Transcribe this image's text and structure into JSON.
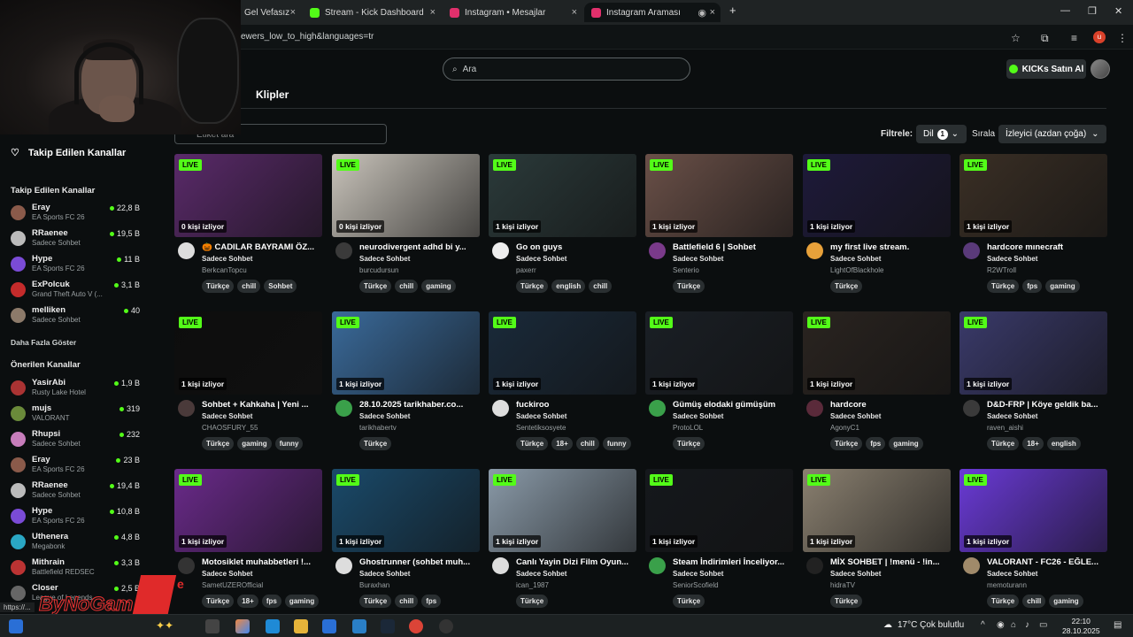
{
  "browser": {
    "tabs": [
      {
        "label": "Gel Vefasız",
        "favicon_color": "#444444"
      },
      {
        "label": "Stream - Kick Dashboard",
        "favicon_color": "#53fc18"
      },
      {
        "label": "Instagram • Mesajlar",
        "favicon_color": "#e1306c"
      },
      {
        "label": "Instagram Araması",
        "favicon_color": "#e1306c"
      }
    ],
    "new_tab": "+",
    "url": "ewers_low_to_high&languages=tr",
    "profile_initial": "u"
  },
  "header": {
    "search_placeholder": "Ara",
    "kicks_label": "KICKs Satın Al",
    "section_title": "Klipler"
  },
  "filters": {
    "tag_placeholder": "Etiket ara",
    "filter_label": "Filtrele:",
    "language_label": "Dil",
    "language_count": "1",
    "sort_label": "Sırala",
    "sort_value": "İzleyici (azdan çoğa)"
  },
  "sidebar": {
    "title": "Takip Edilen Kanallar",
    "followed_title": "Takip Edilen Kanallar",
    "followed": [
      {
        "name": "Eray",
        "game": "EA Sports FC 26",
        "viewers": "22,8 B",
        "color": "#8a5a4a"
      },
      {
        "name": "RRaenee",
        "game": "Sadece Sohbet",
        "viewers": "19,5 B",
        "color": "#bbbbbb"
      },
      {
        "name": "Hype",
        "game": "EA Sports FC 26",
        "viewers": "11 B",
        "color": "#7a4bd6"
      },
      {
        "name": "ExPolcuk",
        "game": "Grand Theft Auto V (...",
        "viewers": "3,1 B",
        "color": "#c42b2b"
      },
      {
        "name": "melliken",
        "game": "Sadece Sohbet",
        "viewers": "40",
        "color": "#8c7a6a"
      }
    ],
    "more_label": "Daha Fazla Göster",
    "recommended_title": "Önerilen Kanallar",
    "recommended": [
      {
        "name": "YasirAbi",
        "game": "Rusty Lake Hotel",
        "viewers": "1,9 B",
        "color": "#a33"
      },
      {
        "name": "mujs",
        "game": "VALORANT",
        "viewers": "319",
        "color": "#6a8a3a"
      },
      {
        "name": "Rhupsi",
        "game": "Sadece Sohbet",
        "viewers": "232",
        "color": "#c77dbb"
      },
      {
        "name": "Eray",
        "game": "EA Sports FC 26",
        "viewers": "23 B",
        "color": "#8a5a4a"
      },
      {
        "name": "RRaenee",
        "game": "Sadece Sohbet",
        "viewers": "19,4 B",
        "color": "#bbbbbb"
      },
      {
        "name": "Hype",
        "game": "EA Sports FC 26",
        "viewers": "10,8 B",
        "color": "#7a4bd6"
      },
      {
        "name": "Uthenera",
        "game": "Megabonk",
        "viewers": "4,8 B",
        "color": "#2aa7c4"
      },
      {
        "name": "Mithrain",
        "game": "Battlefield REDSEC",
        "viewers": "3,3 B",
        "color": "#b33"
      },
      {
        "name": "Closer",
        "game": "League of Legends",
        "viewers": "2,5 B",
        "color": "#666"
      }
    ]
  },
  "live_badge": "LIVE",
  "streams": [
    {
      "title": "🎃 CADILAR BAYRAMI ÖZ...",
      "category": "Sadece Sohbet",
      "user": "BerkcanTopcu",
      "viewers": "0 kişi izliyor",
      "tags": [
        "Türkçe",
        "chill",
        "Sohbet"
      ],
      "thumb": "#5a2a6a",
      "avatar": "#ddd"
    },
    {
      "title": "neurodivergent adhd bi y...",
      "category": "Sadece Sohbet",
      "user": "burcudursun",
      "viewers": "0 kişi izliyor",
      "tags": [
        "Türkçe",
        "chill",
        "gaming"
      ],
      "thumb": "#c9c4bb",
      "avatar": "#3a3a3a"
    },
    {
      "title": "Go on guys",
      "category": "Sadece Sohbet",
      "user": "paxerr",
      "viewers": "1 kişi izliyor",
      "tags": [
        "Türkçe",
        "english",
        "chill"
      ],
      "thumb": "#2b3a3a",
      "avatar": "#eeeeee"
    },
    {
      "title": "Battlefield 6 | Sohbet",
      "category": "Sadece Sohbet",
      "user": "Senterio",
      "viewers": "1 kişi izliyor",
      "tags": [
        "Türkçe"
      ],
      "thumb": "#6a5048",
      "avatar": "#7a3a8a"
    },
    {
      "title": "my first live stream.",
      "category": "Sadece Sohbet",
      "user": "LightOfBlackhole",
      "viewers": "1 kişi izliyor",
      "tags": [
        "Türkçe"
      ],
      "thumb": "#1e1a3a",
      "avatar": "#e8a13a"
    },
    {
      "title": "hardcore mınecraft",
      "category": "Sadece Sohbet",
      "user": "R2WTroll",
      "viewers": "1 kişi izliyor",
      "tags": [
        "Türkçe",
        "fps",
        "gaming"
      ],
      "thumb": "#3a2f25",
      "avatar": "#5a3a7a"
    },
    {
      "title": "Sohbet + Kahkaha | Yeni ...",
      "category": "Sadece Sohbet",
      "user": "CHAOSFURY_55",
      "viewers": "1 kişi izliyor",
      "tags": [
        "Türkçe",
        "gaming",
        "funny"
      ],
      "thumb": "#0d0d0d",
      "avatar": "#4a3a3a"
    },
    {
      "title": "28.10.2025 tarikhaber.co...",
      "category": "Sadece Sohbet",
      "user": "tarikhabertv",
      "viewers": "1 kişi izliyor",
      "tags": [
        "Türkçe"
      ],
      "thumb": "#3a6a9a",
      "avatar": "#3aa04a"
    },
    {
      "title": "fuckiroo",
      "category": "Sadece Sohbet",
      "user": "Sentetiksosyete",
      "viewers": "1 kişi izliyor",
      "tags": [
        "Türkçe",
        "18+",
        "chill",
        "funny"
      ],
      "thumb": "#1a2a3a",
      "avatar": "#ddd"
    },
    {
      "title": "Gümüş elodaki gümüşüm",
      "category": "Sadece Sohbet",
      "user": "ProtoLOL",
      "viewers": "1 kişi izliyor",
      "tags": [
        "Türkçe"
      ],
      "thumb": "#1a1f25",
      "avatar": "#3aa04a"
    },
    {
      "title": "hardcore",
      "category": "Sadece Sohbet",
      "user": "AgonyC1",
      "viewers": "1 kişi izliyor",
      "tags": [
        "Türkçe",
        "fps",
        "gaming"
      ],
      "thumb": "#2a2420",
      "avatar": "#5a2a3a"
    },
    {
      "title": "D&D-FRP | Köye geldik ba...",
      "category": "Sadece Sohbet",
      "user": "raven_aishi",
      "viewers": "1 kişi izliyor",
      "tags": [
        "Türkçe",
        "18+",
        "english"
      ],
      "thumb": "#3a3a6a",
      "avatar": "#3a3a3a"
    },
    {
      "title": "Motosiklet muhabbetleri !...",
      "category": "Sadece Sohbet",
      "user": "SametUZEROfficial",
      "viewers": "1 kişi izliyor",
      "tags": [
        "Türkçe",
        "18+",
        "fps",
        "gaming"
      ],
      "thumb": "#6a2a8a",
      "avatar": "#333"
    },
    {
      "title": "Ghostrunner (sohbet muh...",
      "category": "Sadece Sohbet",
      "user": "Buraxhan",
      "viewers": "1 kişi izliyor",
      "tags": [
        "Türkçe",
        "chill",
        "fps"
      ],
      "thumb": "#1a4a6a",
      "avatar": "#ddd"
    },
    {
      "title": "Canlı Yayin Dizi Film Oyun...",
      "category": "Sadece Sohbet",
      "user": "ican_1987",
      "viewers": "1 kişi izliyor",
      "tags": [
        "Türkçe"
      ],
      "thumb": "#8a9aa8",
      "avatar": "#ddd"
    },
    {
      "title": "Steam İndirimleri İnceliyor...",
      "category": "Sadece Sohbet",
      "user": "SeniorScofield",
      "viewers": "1 kişi izliyor",
      "tags": [
        "Türkçe"
      ],
      "thumb": "#15181c",
      "avatar": "#3aa04a"
    },
    {
      "title": "MİX SOHBET | !menü - !in...",
      "category": "Sadece Sohbet",
      "user": "hidraTV",
      "viewers": "1 kişi izliyor",
      "tags": [
        "Türkçe"
      ],
      "thumb": "#8a8070",
      "avatar": "#222"
    },
    {
      "title": "VALORANT - FC26 - EĞLE...",
      "category": "Sadece Sohbet",
      "user": "memoturann",
      "viewers": "1 kişi izliyor",
      "tags": [
        "Türkçe",
        "chill",
        "gaming"
      ],
      "thumb": "#6a3ad6",
      "avatar": "#a08a6a"
    }
  ],
  "watermark": {
    "text": "ByNoGam",
    "suffix": "e"
  },
  "status_url": "https://...",
  "taskbar": {
    "weather": "17°C  Çok bulutlu",
    "time": "22:10",
    "date": "28.10.2025"
  }
}
